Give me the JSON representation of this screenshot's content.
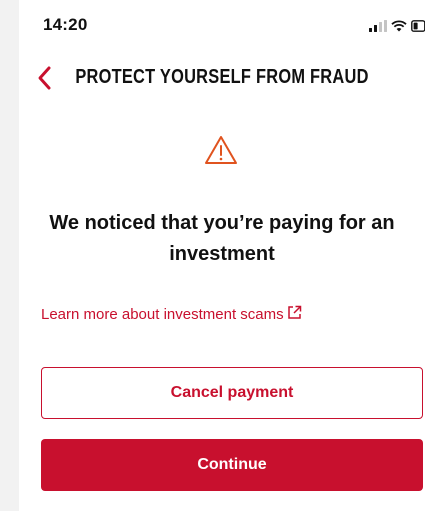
{
  "status_bar": {
    "time": "14:20",
    "icons": [
      "signal-icon",
      "wifi-icon",
      "battery-icon"
    ]
  },
  "header": {
    "back_icon": "chevron-left-icon",
    "title": "PROTECT YOURSELF FROM FRAUD"
  },
  "alert": {
    "icon": "warning-icon",
    "headline": "We noticed that you’re paying for an investment"
  },
  "link": {
    "label": "Learn more about investment scams",
    "icon": "external-link-icon"
  },
  "actions": {
    "cancel_label": "Cancel payment",
    "continue_label": "Continue"
  },
  "colors": {
    "brand_red": "#c8102e",
    "warning_orange": "#e0531f",
    "text": "#111111",
    "background": "#ffffff"
  }
}
